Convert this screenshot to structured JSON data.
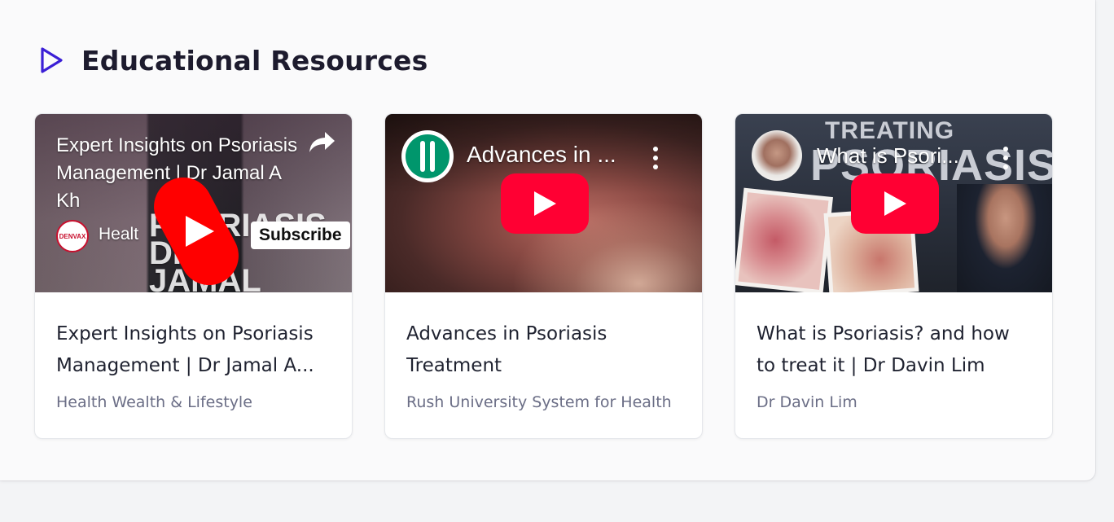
{
  "section": {
    "title": "Educational Resources",
    "icon": "play-outline-icon",
    "accent_color": "#3b1fd6"
  },
  "videos": [
    {
      "overlay_title": "Expert Insights on Psoriasis Management | Dr Jamal A Kh",
      "overlay_channel": "Healt",
      "subscribe_label": "Subscribe",
      "channel_logo_text": "DENVAX",
      "thumb_text": "PSORIASIS DR JAMAL A KHAN",
      "title": "Expert Insights on Psoriasis Management | Dr Jamal A...",
      "channel": "Health Wealth & Lifestyle",
      "player": "shorts"
    },
    {
      "overlay_title": "Advances in ...",
      "title": "Advances in Psoriasis Treatment",
      "channel": "Rush University System for Health",
      "player": "standard"
    },
    {
      "overlay_title": "What is Psori...",
      "thumb_text_top": "TREATING",
      "thumb_text_big": "PSORIASIS",
      "title": "What is Psoriasis? and how to treat it | Dr Davin Lim",
      "channel": "Dr Davin Lim",
      "player": "standard"
    }
  ]
}
